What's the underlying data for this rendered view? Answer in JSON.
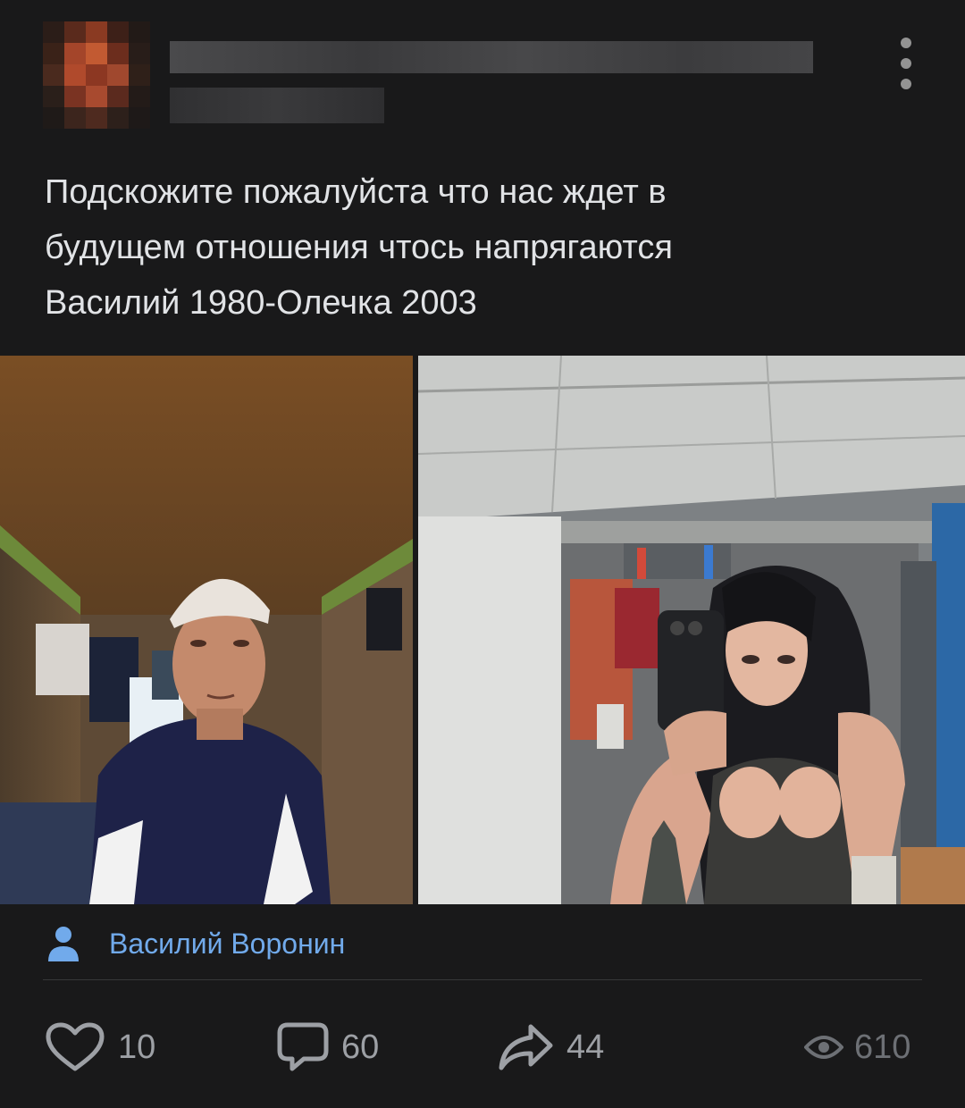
{
  "post": {
    "text_lines": [
      "Подскожите пожалуйста что нас ждет в",
      "будущем отношения чтось напрягаются",
      "Василий 1980-Олечка 2003"
    ],
    "author_name": "Василий Воронин"
  },
  "actions": {
    "likes": "10",
    "comments": "60",
    "shares": "44",
    "views": "610"
  },
  "colors": {
    "background": "#19191a",
    "link": "#71aaeb",
    "text": "#e1e3e6",
    "icon": "#9da0a5"
  },
  "icons": [
    "more-vertical-icon",
    "person-icon",
    "heart-icon",
    "comment-icon",
    "share-icon",
    "eye-icon"
  ]
}
